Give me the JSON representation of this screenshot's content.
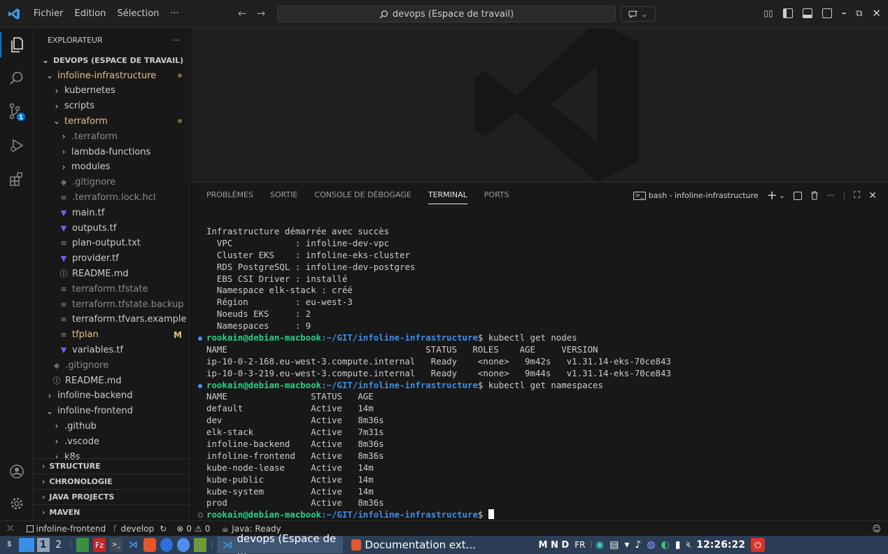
{
  "titlebar": {
    "menu": [
      "Fichier",
      "Edition",
      "Sélection",
      "···"
    ],
    "search": "devops (Espace de travail)"
  },
  "sidebar": {
    "header": "EXPLORATEUR",
    "more": "···",
    "workspace": "DEVOPS (ESPACE DE TRAVAIL)",
    "tree": [
      {
        "label": "infoline-infrastructure",
        "level": 1,
        "chev": "open",
        "color": "#e2c08d",
        "dot": true
      },
      {
        "label": "kubernetes",
        "level": 2,
        "chev": "closed",
        "color": "#cccccc"
      },
      {
        "label": "scripts",
        "level": 2,
        "chev": "closed",
        "color": "#cccccc"
      },
      {
        "label": "terraform",
        "level": 2,
        "chev": "open",
        "color": "#e2c08d",
        "dot": true
      },
      {
        "label": ".terraform",
        "level": 3,
        "chev": "closed",
        "color": "#8b8b8b"
      },
      {
        "label": "lambda-functions",
        "level": 3,
        "chev": "closed",
        "color": "#cccccc"
      },
      {
        "label": "modules",
        "level": 3,
        "chev": "closed",
        "color": "#cccccc"
      },
      {
        "label": ".gitignore",
        "level": 3,
        "icon": "git",
        "color": "#8b8b8b"
      },
      {
        "label": ".terraform.lock.hcl",
        "level": 3,
        "icon": "lines",
        "color": "#8b8b8b"
      },
      {
        "label": "main.tf",
        "level": 3,
        "icon": "tf",
        "color": "#cccccc"
      },
      {
        "label": "outputs.tf",
        "level": 3,
        "icon": "tf",
        "color": "#cccccc"
      },
      {
        "label": "plan-output.txt",
        "level": 3,
        "icon": "lines",
        "color": "#cccccc"
      },
      {
        "label": "provider.tf",
        "level": 3,
        "icon": "tf",
        "color": "#cccccc"
      },
      {
        "label": "README.md",
        "level": 3,
        "icon": "info",
        "color": "#cccccc"
      },
      {
        "label": "terraform.tfstate",
        "level": 3,
        "icon": "lines",
        "color": "#8b8b8b"
      },
      {
        "label": "terraform.tfstate.backup",
        "level": 3,
        "icon": "lines",
        "color": "#8b8b8b"
      },
      {
        "label": "terraform.tfvars.example",
        "level": 3,
        "icon": "lines",
        "color": "#cccccc"
      },
      {
        "label": "tfplan",
        "level": 3,
        "icon": "lines",
        "color": "#e2c08d",
        "mod": "M"
      },
      {
        "label": "variables.tf",
        "level": 3,
        "icon": "tf",
        "color": "#cccccc"
      },
      {
        "label": ".gitignore",
        "level": 2,
        "icon": "git",
        "color": "#8b8b8b"
      },
      {
        "label": "README.md",
        "level": 2,
        "icon": "info",
        "color": "#cccccc"
      },
      {
        "label": "infoline-backend",
        "level": 1,
        "chev": "closed",
        "color": "#cccccc"
      },
      {
        "label": "infoline-frontend",
        "level": 1,
        "chev": "open",
        "color": "#cccccc"
      },
      {
        "label": ".github",
        "level": 2,
        "chev": "closed",
        "color": "#cccccc"
      },
      {
        "label": ".vscode",
        "level": 2,
        "chev": "closed",
        "color": "#cccccc"
      },
      {
        "label": "k8s",
        "level": 2,
        "chev": "closed",
        "color": "#cccccc"
      }
    ],
    "sections": [
      "STRUCTURE",
      "CHRONOLOGIE",
      "JAVA PROJECTS",
      "MAVEN"
    ]
  },
  "panel": {
    "tabs": [
      "PROBLÈMES",
      "SORTIE",
      "CONSOLE DE DÉBOGAGE",
      "TERMINAL",
      "PORTS"
    ],
    "active_tab": "TERMINAL",
    "terminal_name": "bash - infoline-infrastructure"
  },
  "terminal": {
    "summary": [
      "Infrastructure démarrée avec succès",
      "  VPC            : infoline-dev-vpc",
      "  Cluster EKS    : infoline-eks-cluster",
      "  RDS PostgreSQL : infoline-dev-postgres",
      "  EBS CSI Driver : installé",
      "  Namespace elk-stack : créé",
      "  Région         : eu-west-3",
      "  Noeuds EKS     : 2",
      "  Namespaces     : 9"
    ],
    "prompt_user": "rookain@debian-macbook",
    "prompt_path": ":~/GIT/infoline-infrastructure",
    "prompt_suffix": "$ ",
    "cmd1": "kubectl get nodes",
    "nodes": [
      "NAME                                      STATUS   ROLES    AGE     VERSION",
      "ip-10-0-2-168.eu-west-3.compute.internal   Ready    <none>   9m42s   v1.31.14-eks-70ce843",
      "ip-10-0-3-219.eu-west-3.compute.internal   Ready    <none>   9m44s   v1.31.14-eks-70ce843"
    ],
    "cmd2": "kubectl get namespaces",
    "namespaces": [
      "NAME                STATUS   AGE",
      "default             Active   14m",
      "dev                 Active   8m36s",
      "elk-stack           Active   7m31s",
      "infoline-backend    Active   8m36s",
      "infoline-frontend   Active   8m36s",
      "kube-node-lease     Active   14m",
      "kube-public         Active   14m",
      "kube-system         Active   14m",
      "prod                Active   8m36s"
    ]
  },
  "statusbar": {
    "folder": "infoline-frontend",
    "branch": "develop",
    "errors": "0",
    "warnings": "0",
    "java": "Java: Ready"
  },
  "taskbar": {
    "ws1": "1",
    "ws2": "2",
    "win1": "devops (Espace de ...",
    "win2": "Documentation ext...",
    "kbd": "M N D",
    "lang": "FR",
    "clock": "12:26:22"
  }
}
